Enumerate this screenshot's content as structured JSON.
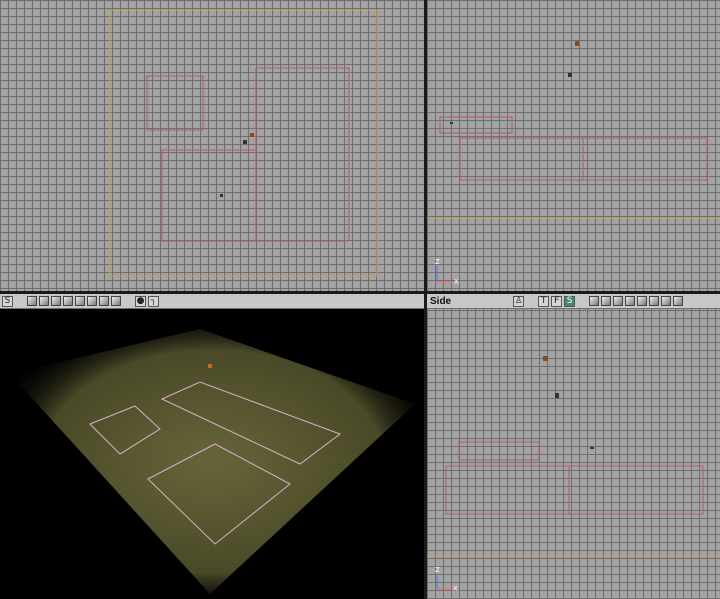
{
  "viewports": {
    "side": {
      "title": "Side",
      "toolbar": {
        "btn_t": "T",
        "btn_f": "F",
        "btn_s": "S"
      },
      "axis_x": "X",
      "axis_z": "Z"
    },
    "perspective": {
      "toolbar": {
        "btn_s": "S"
      }
    },
    "front": {
      "axis_x": "X",
      "axis_z": "Z"
    }
  },
  "icons": [
    "cube-icon",
    "eye-icon",
    "paint-icon",
    "actor-icon",
    "light-icon"
  ],
  "colors": {
    "grid_bg": "#a3a3a3",
    "brush_outline": "#b05a6a",
    "world_boundary": "#c8a040",
    "axis_z": "#3a7cff",
    "axis_x": "#ff6060",
    "active_mode": "#3e8b6f"
  }
}
